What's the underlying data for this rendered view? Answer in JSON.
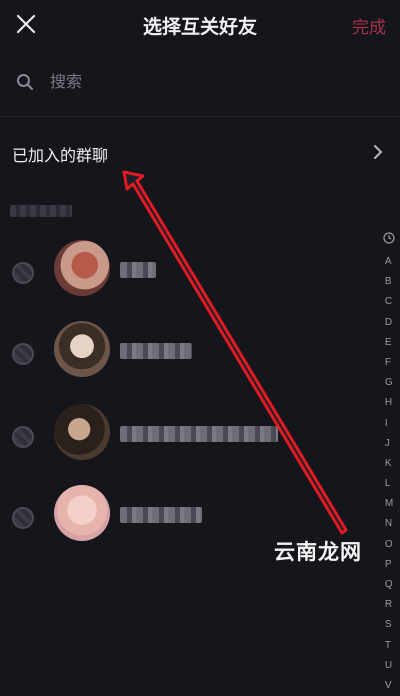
{
  "header": {
    "title": "选择互关好友",
    "done_label": "完成",
    "done_color": "#a4304b"
  },
  "search": {
    "placeholder": "搜索",
    "value": ""
  },
  "joined_groups": {
    "label": "已加入的群聊"
  },
  "contacts": [
    {
      "avatar": "avatar-1"
    },
    {
      "avatar": "avatar-2"
    },
    {
      "avatar": "avatar-3"
    },
    {
      "avatar": "avatar-4"
    }
  ],
  "index_bar": {
    "letters": [
      "A",
      "B",
      "C",
      "D",
      "E",
      "F",
      "G",
      "H",
      "I",
      "J",
      "K",
      "L",
      "M",
      "N",
      "O",
      "P",
      "Q",
      "R",
      "S",
      "T",
      "U",
      "V"
    ]
  },
  "watermark": "云南龙网",
  "icons": [
    "close-icon",
    "search-icon",
    "chevron-right-icon",
    "clock-icon"
  ]
}
